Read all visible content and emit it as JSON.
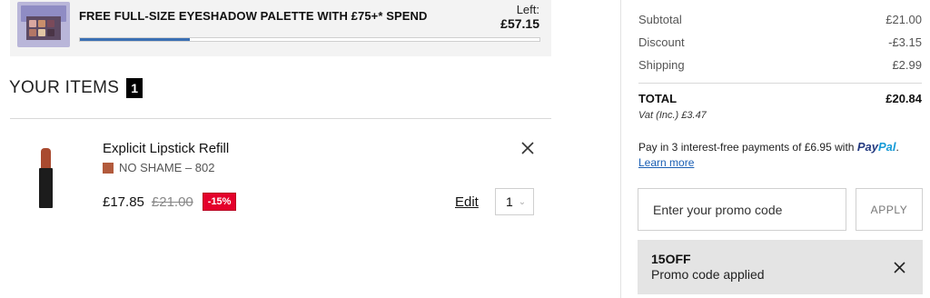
{
  "banner": {
    "title": "FREE FULL-SIZE EYESHADOW PALETTE WITH £75+* SPEND",
    "left_label": "Left:",
    "left_value": "£57.15",
    "progress_fraction": 0.24,
    "thumb_icon": "eyeshadow-palette-image"
  },
  "items": {
    "heading": "YOUR ITEMS",
    "count": "1",
    "list": [
      {
        "name": "Explicit Lipstick Refill",
        "shade": "NO SHAME – 802",
        "shade_color": "#b25a3c",
        "price_now": "£17.85",
        "price_was": "£21.00",
        "discount": "-15%",
        "edit_label": "Edit",
        "quantity": "1"
      }
    ]
  },
  "summary": {
    "subtotal_label": "Subtotal",
    "subtotal_value": "£21.00",
    "discount_label": "Discount",
    "discount_value": "-£3.15",
    "shipping_label": "Shipping",
    "shipping_value": "£2.99",
    "total_label": "TOTAL",
    "total_value": "£20.84",
    "vat_text": "Vat (Inc.)  £3.47"
  },
  "paypal": {
    "text": "Pay in 3 interest-free payments of £6.95 with",
    "logo_part1": "Pay",
    "logo_part2": "Pal",
    "logo_suffix": ".",
    "learn_more": "Learn more"
  },
  "promo": {
    "placeholder": "Enter your promo code",
    "apply_label": "APPLY",
    "applied_code": "15OFF",
    "applied_message": "Promo code applied"
  },
  "colors": {
    "accent_blue": "#3a6fb3",
    "discount_red": "#e4002b",
    "paypal_dark": "#253b80",
    "paypal_light": "#179bd7"
  }
}
